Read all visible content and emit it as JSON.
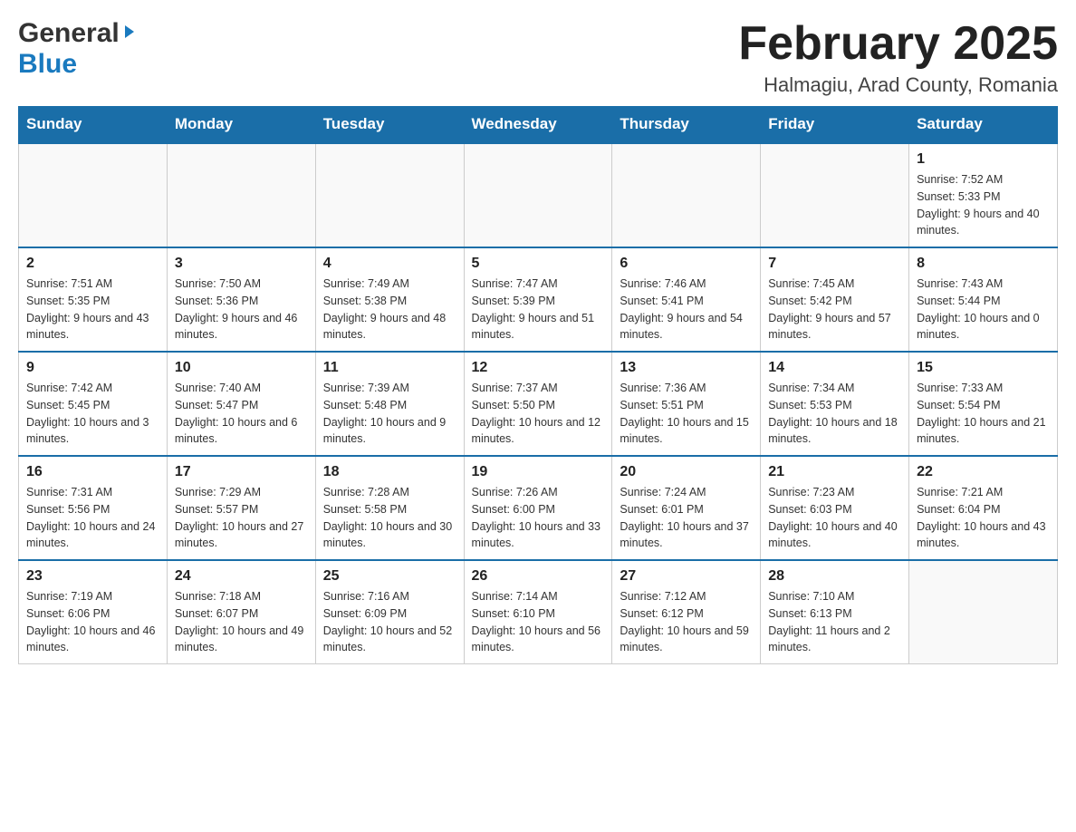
{
  "header": {
    "title": "February 2025",
    "subtitle": "Halmagiu, Arad County, Romania"
  },
  "logo": {
    "general": "General",
    "blue": "Blue"
  },
  "days_of_week": [
    "Sunday",
    "Monday",
    "Tuesday",
    "Wednesday",
    "Thursday",
    "Friday",
    "Saturday"
  ],
  "weeks": [
    [
      {
        "day": "",
        "info": ""
      },
      {
        "day": "",
        "info": ""
      },
      {
        "day": "",
        "info": ""
      },
      {
        "day": "",
        "info": ""
      },
      {
        "day": "",
        "info": ""
      },
      {
        "day": "",
        "info": ""
      },
      {
        "day": "1",
        "info": "Sunrise: 7:52 AM\nSunset: 5:33 PM\nDaylight: 9 hours and 40 minutes."
      }
    ],
    [
      {
        "day": "2",
        "info": "Sunrise: 7:51 AM\nSunset: 5:35 PM\nDaylight: 9 hours and 43 minutes."
      },
      {
        "day": "3",
        "info": "Sunrise: 7:50 AM\nSunset: 5:36 PM\nDaylight: 9 hours and 46 minutes."
      },
      {
        "day": "4",
        "info": "Sunrise: 7:49 AM\nSunset: 5:38 PM\nDaylight: 9 hours and 48 minutes."
      },
      {
        "day": "5",
        "info": "Sunrise: 7:47 AM\nSunset: 5:39 PM\nDaylight: 9 hours and 51 minutes."
      },
      {
        "day": "6",
        "info": "Sunrise: 7:46 AM\nSunset: 5:41 PM\nDaylight: 9 hours and 54 minutes."
      },
      {
        "day": "7",
        "info": "Sunrise: 7:45 AM\nSunset: 5:42 PM\nDaylight: 9 hours and 57 minutes."
      },
      {
        "day": "8",
        "info": "Sunrise: 7:43 AM\nSunset: 5:44 PM\nDaylight: 10 hours and 0 minutes."
      }
    ],
    [
      {
        "day": "9",
        "info": "Sunrise: 7:42 AM\nSunset: 5:45 PM\nDaylight: 10 hours and 3 minutes."
      },
      {
        "day": "10",
        "info": "Sunrise: 7:40 AM\nSunset: 5:47 PM\nDaylight: 10 hours and 6 minutes."
      },
      {
        "day": "11",
        "info": "Sunrise: 7:39 AM\nSunset: 5:48 PM\nDaylight: 10 hours and 9 minutes."
      },
      {
        "day": "12",
        "info": "Sunrise: 7:37 AM\nSunset: 5:50 PM\nDaylight: 10 hours and 12 minutes."
      },
      {
        "day": "13",
        "info": "Sunrise: 7:36 AM\nSunset: 5:51 PM\nDaylight: 10 hours and 15 minutes."
      },
      {
        "day": "14",
        "info": "Sunrise: 7:34 AM\nSunset: 5:53 PM\nDaylight: 10 hours and 18 minutes."
      },
      {
        "day": "15",
        "info": "Sunrise: 7:33 AM\nSunset: 5:54 PM\nDaylight: 10 hours and 21 minutes."
      }
    ],
    [
      {
        "day": "16",
        "info": "Sunrise: 7:31 AM\nSunset: 5:56 PM\nDaylight: 10 hours and 24 minutes."
      },
      {
        "day": "17",
        "info": "Sunrise: 7:29 AM\nSunset: 5:57 PM\nDaylight: 10 hours and 27 minutes."
      },
      {
        "day": "18",
        "info": "Sunrise: 7:28 AM\nSunset: 5:58 PM\nDaylight: 10 hours and 30 minutes."
      },
      {
        "day": "19",
        "info": "Sunrise: 7:26 AM\nSunset: 6:00 PM\nDaylight: 10 hours and 33 minutes."
      },
      {
        "day": "20",
        "info": "Sunrise: 7:24 AM\nSunset: 6:01 PM\nDaylight: 10 hours and 37 minutes."
      },
      {
        "day": "21",
        "info": "Sunrise: 7:23 AM\nSunset: 6:03 PM\nDaylight: 10 hours and 40 minutes."
      },
      {
        "day": "22",
        "info": "Sunrise: 7:21 AM\nSunset: 6:04 PM\nDaylight: 10 hours and 43 minutes."
      }
    ],
    [
      {
        "day": "23",
        "info": "Sunrise: 7:19 AM\nSunset: 6:06 PM\nDaylight: 10 hours and 46 minutes."
      },
      {
        "day": "24",
        "info": "Sunrise: 7:18 AM\nSunset: 6:07 PM\nDaylight: 10 hours and 49 minutes."
      },
      {
        "day": "25",
        "info": "Sunrise: 7:16 AM\nSunset: 6:09 PM\nDaylight: 10 hours and 52 minutes."
      },
      {
        "day": "26",
        "info": "Sunrise: 7:14 AM\nSunset: 6:10 PM\nDaylight: 10 hours and 56 minutes."
      },
      {
        "day": "27",
        "info": "Sunrise: 7:12 AM\nSunset: 6:12 PM\nDaylight: 10 hours and 59 minutes."
      },
      {
        "day": "28",
        "info": "Sunrise: 7:10 AM\nSunset: 6:13 PM\nDaylight: 11 hours and 2 minutes."
      },
      {
        "day": "",
        "info": ""
      }
    ]
  ]
}
